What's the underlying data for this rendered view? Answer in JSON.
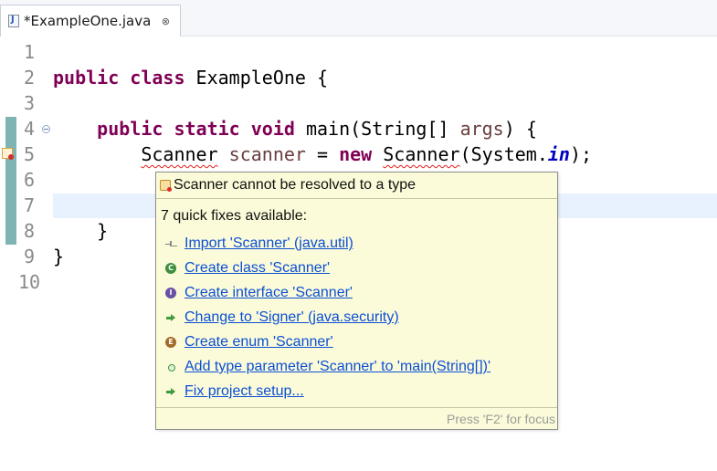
{
  "tab": {
    "title": "*ExampleOne.java",
    "icon": "java-file-icon",
    "close_glyph": "⊗"
  },
  "editor": {
    "line_numbers": [
      "1",
      "2",
      "3",
      "4",
      "5",
      "6",
      "7",
      "8",
      "9",
      "10"
    ],
    "code": {
      "l2_kw1": "public",
      "l2_kw2": "class",
      "l2_rest": " ExampleOne {",
      "l4_kw1": "public",
      "l4_kw2": "static",
      "l4_kw3": "void",
      "l4_a": " main(String[] ",
      "l4_param": "args",
      "l4_b": ") {",
      "l5_type": "Scanner",
      "l5_sp1": " ",
      "l5_var": "scanner",
      "l5_eq": " = ",
      "l5_new": "new",
      "l5_sp2": " ",
      "l5_ctor": "Scanner",
      "l5_a": "(System.",
      "l5_field": "in",
      "l5_b": ");",
      "l8_text": "    }",
      "l9_text": "}"
    }
  },
  "quickfix": {
    "header": "Scanner cannot be resolved to a type",
    "count": "7 quick fixes available:",
    "fixes": [
      {
        "label": "Import 'Scanner' (java.util)",
        "icon": "import-icon"
      },
      {
        "label": "Create class 'Scanner'",
        "icon": "class-icon",
        "glyph": "C"
      },
      {
        "label": "Create interface 'Scanner'",
        "icon": "interface-icon",
        "glyph": "I"
      },
      {
        "label": "Change to 'Signer' (java.security)",
        "icon": "change-icon"
      },
      {
        "label": "Create enum 'Scanner'",
        "icon": "enum-icon",
        "glyph": "E"
      },
      {
        "label": "Add type parameter 'Scanner' to 'main(String[])'",
        "icon": "type-parameter-icon"
      },
      {
        "label": "Fix project setup...",
        "icon": "fix-setup-icon"
      }
    ],
    "footer": "Press 'F2' for focus"
  },
  "colors": {
    "keyword": "#7f0055",
    "link": "#0b4fd6",
    "popup_bg": "#fbfbd9",
    "current_line": "#e8f2fe",
    "error": "#e02020"
  }
}
